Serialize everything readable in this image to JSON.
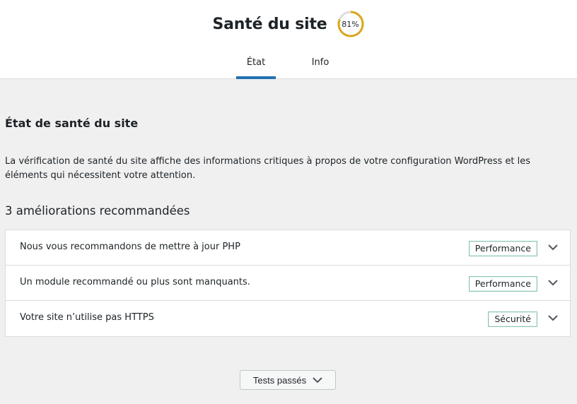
{
  "header": {
    "title": "Santé du site",
    "score_label": "81%",
    "score_value": 81,
    "score_color": "#dba617"
  },
  "tabs": [
    {
      "label": "État",
      "active": true
    },
    {
      "label": "Info",
      "active": false
    }
  ],
  "main": {
    "section_title": "État de santé du site",
    "description": "La vérification de santé du site affiche des informations critiques à propos de votre configuration WordPress et les éléments qui nécessitent votre attention.",
    "count_heading": "3 améliorations recommandées",
    "issues": [
      {
        "label": "Nous vous recommandons de mettre à jour PHP",
        "badge": "Performance",
        "icon": "chevron-down-icon"
      },
      {
        "label": "Un module recommandé ou plus sont manquants.",
        "badge": "Performance",
        "icon": "chevron-down-icon"
      },
      {
        "label": "Votre site n’utilise pas HTTPS",
        "badge": "Sécurité",
        "icon": "chevron-down-icon"
      }
    ],
    "passed_button": "Tests passés"
  },
  "colors": {
    "accent": "#2271b1",
    "badge_border": "#8ac6b5"
  }
}
